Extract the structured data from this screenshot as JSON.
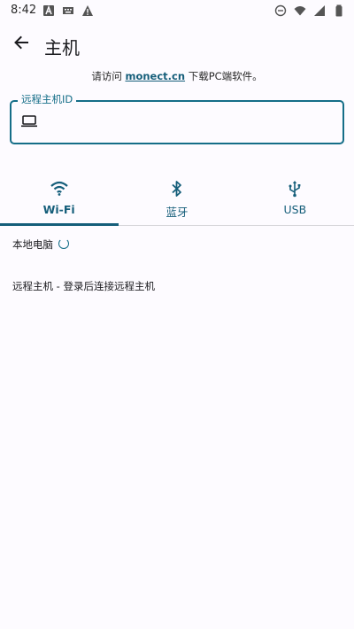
{
  "status_bar": {
    "time": "8:42",
    "left_icons": [
      "letter-a-icon",
      "keyboard-icon",
      "warning-icon"
    ],
    "right_icons": [
      "do-not-disturb-icon",
      "wifi-icon",
      "signal-icon",
      "battery-icon"
    ]
  },
  "app_bar": {
    "title": "主机",
    "back_icon": "arrow-back-icon"
  },
  "hint": {
    "prefix": "请访问 ",
    "link": "monect.cn",
    "suffix": " 下载PC端软件。"
  },
  "remote_id_field": {
    "label": "远程主机ID",
    "value": "",
    "icon": "laptop-icon"
  },
  "tabs": [
    {
      "label": "Wi-Fi",
      "icon": "wifi-icon",
      "active": true
    },
    {
      "label": "蓝牙",
      "icon": "bluetooth-icon",
      "active": false
    },
    {
      "label": "USB",
      "icon": "usb-icon",
      "active": false
    }
  ],
  "local_pc": {
    "label": "本地电脑"
  },
  "remote_host": {
    "label": "远程主机 - 登录后连接远程主机"
  },
  "colors": {
    "accent": "#155e7a",
    "background": "#fdfbff",
    "text": "#1b1b1f"
  }
}
